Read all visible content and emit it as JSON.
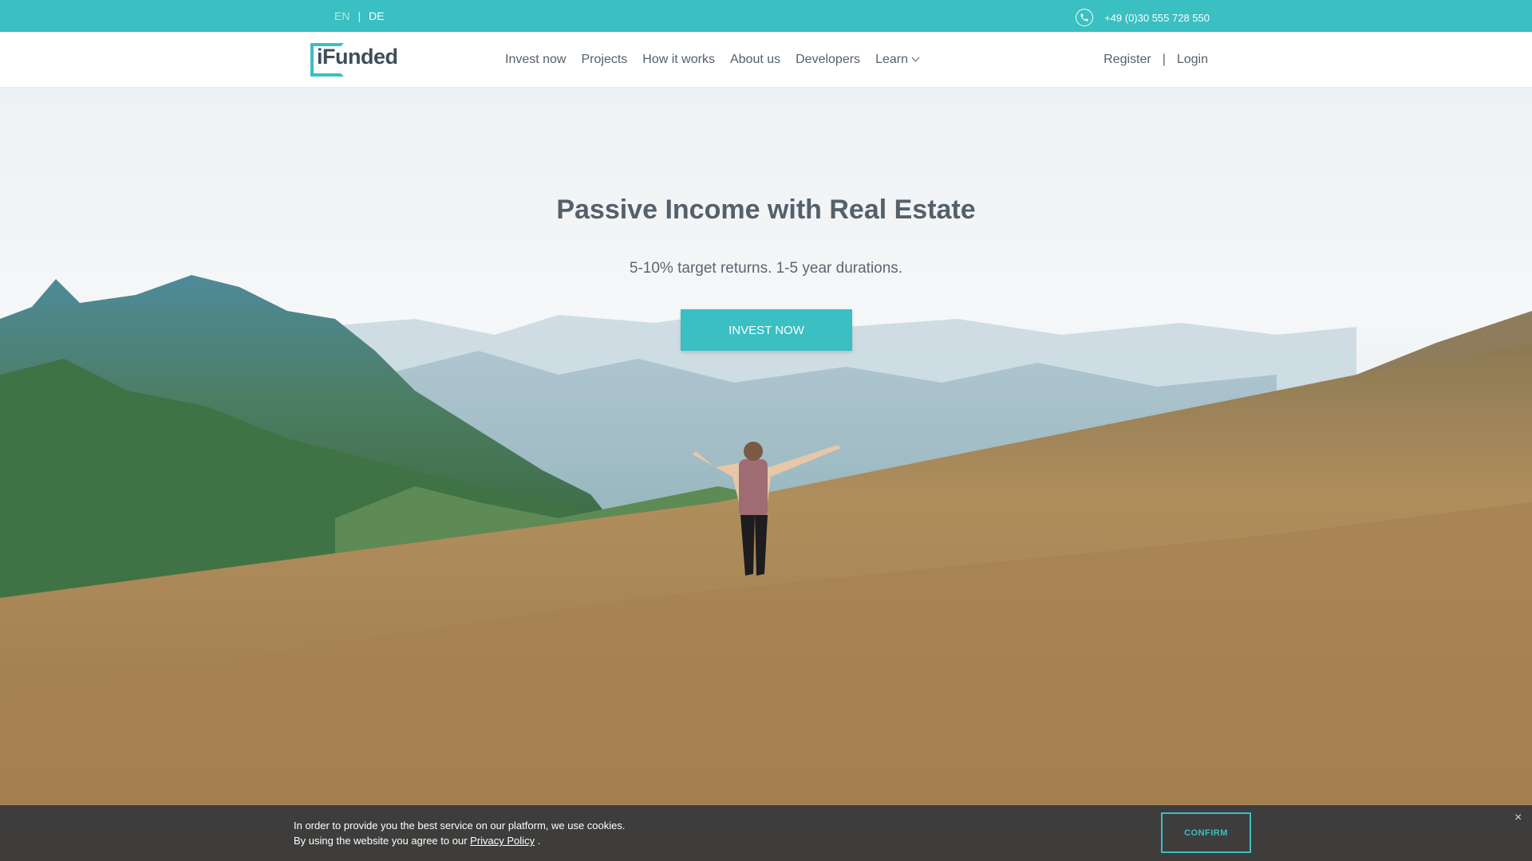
{
  "topbar": {
    "lang_en": "EN",
    "lang_sep": "|",
    "lang_de": "DE",
    "phone": "+49 (0)30 555 728 550"
  },
  "header": {
    "logo": "iFunded",
    "nav": [
      "Invest now",
      "Projects",
      "How it works",
      "About us",
      "Developers",
      "Learn"
    ],
    "register": "Register",
    "auth_sep": "|",
    "login": "Login"
  },
  "hero": {
    "title": "Passive Income with Real Estate",
    "subtitle": "5-10% target returns. 1-5 year durations.",
    "button": "INVEST NOW"
  },
  "cookie": {
    "line1": "In order to provide you the best service on our platform, we use cookies.",
    "line2_prefix": "By using the website you agree to our",
    "link": "Privacy Policy",
    "line2_suffix": ".",
    "confirm": "CONFIRM",
    "close": "×"
  },
  "colors": {
    "accent": "#3abfc2",
    "text": "#55606b",
    "cookie_bg": "#30343a"
  }
}
